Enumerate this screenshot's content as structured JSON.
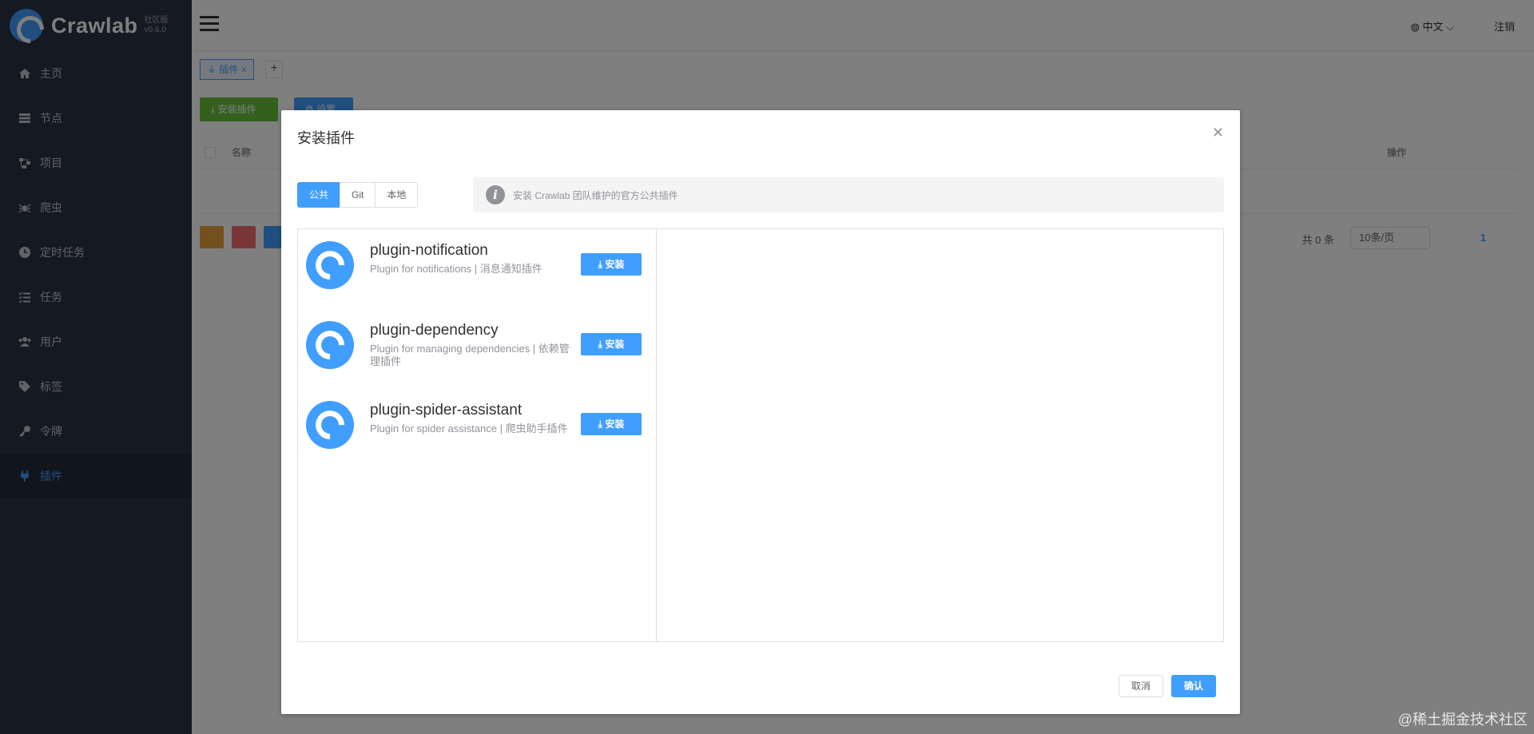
{
  "app": {
    "name": "Crawlab",
    "edition": "社区版",
    "version": "v0.6.0"
  },
  "sidebar": {
    "items": [
      {
        "label": "主页",
        "icon": "home-icon"
      },
      {
        "label": "节点",
        "icon": "server-icon"
      },
      {
        "label": "项目",
        "icon": "project-icon"
      },
      {
        "label": "爬虫",
        "icon": "spider-icon"
      },
      {
        "label": "定时任务",
        "icon": "clock-icon"
      },
      {
        "label": "任务",
        "icon": "task-list-icon"
      },
      {
        "label": "用户",
        "icon": "users-icon"
      },
      {
        "label": "标签",
        "icon": "tag-icon"
      },
      {
        "label": "令牌",
        "icon": "key-icon"
      },
      {
        "label": "插件",
        "icon": "plug-icon",
        "active": true
      }
    ]
  },
  "topbar": {
    "language": "中文",
    "logout": "注销"
  },
  "tabs": [
    {
      "label": "插件"
    }
  ],
  "page": {
    "install_button": "安装插件",
    "settings_button": "设置",
    "table_headers": [
      "名称",
      "操作"
    ],
    "total_text": "共 0 条",
    "page_size": "10条/页",
    "current_page": "1"
  },
  "dialog": {
    "title": "安装插件",
    "sources": [
      "公共",
      "Git",
      "本地"
    ],
    "active_source": "公共",
    "info_text": "安装 Crawlab 团队维护的官方公共插件",
    "plugins": [
      {
        "name": "plugin-notification",
        "description": "Plugin for notifications | 消息通知插件",
        "install_label": "安装"
      },
      {
        "name": "plugin-dependency",
        "description": "Plugin for managing dependencies | 依赖管理插件",
        "install_label": "安装"
      },
      {
        "name": "plugin-spider-assistant",
        "description": "Plugin for spider assistance | 爬虫助手插件",
        "install_label": "安装"
      }
    ],
    "cancel_label": "取消",
    "confirm_label": "确认"
  },
  "watermark": "@稀土掘金技术社区",
  "colors": {
    "primary": "#409eff",
    "success": "#67c23a",
    "sidebar_bg": "#2a3344"
  }
}
